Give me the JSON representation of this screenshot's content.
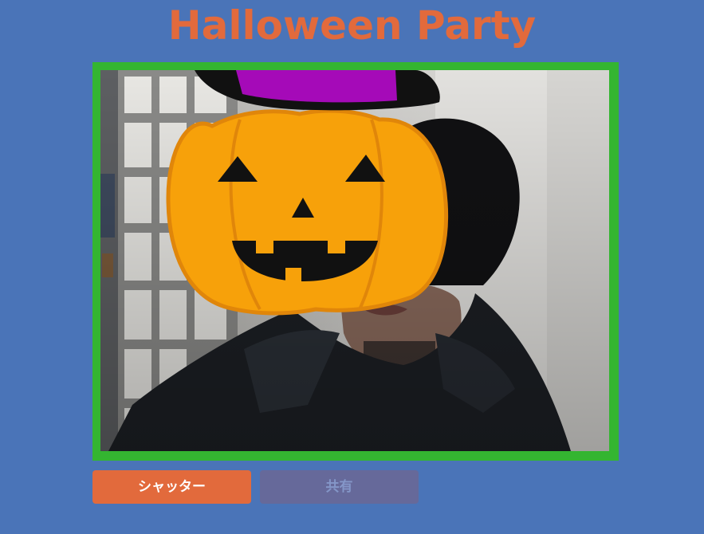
{
  "page": {
    "title": "Halloween Party"
  },
  "camera": {
    "overlay_icon": "jack-o-lantern-with-witch-hat-icon",
    "frame_color": "#34b531"
  },
  "buttons": {
    "shutter_label": "シャッター",
    "share_label": "共有"
  },
  "colors": {
    "background": "#4a74b8",
    "accent": "#e26a3c",
    "disabled_button": "#66699a"
  }
}
